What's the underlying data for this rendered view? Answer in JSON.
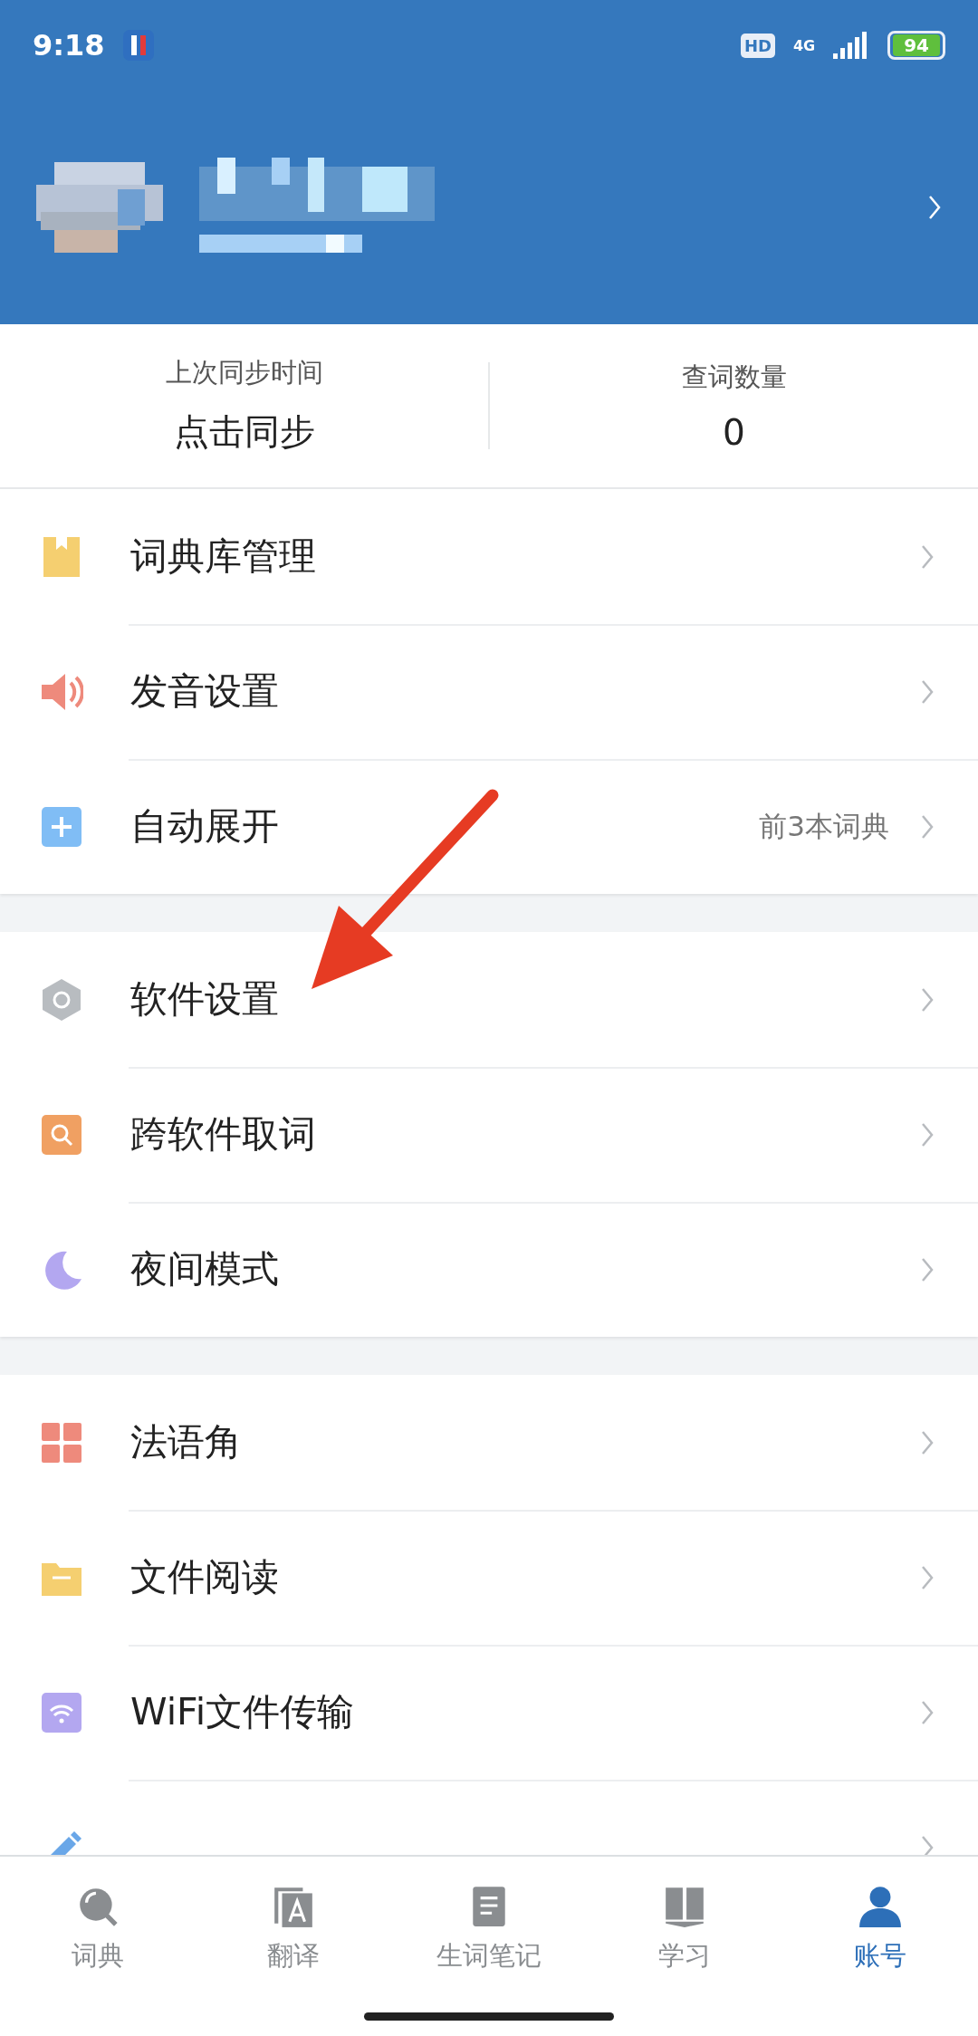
{
  "status_bar": {
    "time": "9:18",
    "hd": "HD",
    "network": "4G",
    "battery": "94"
  },
  "stats": [
    {
      "label": "上次同步时间",
      "value": "点击同步"
    },
    {
      "label": "查词数量",
      "value": "0"
    }
  ],
  "groups": [
    [
      {
        "kind": "bookmark",
        "label": "词典库管理"
      },
      {
        "kind": "speaker",
        "label": "发音设置"
      },
      {
        "kind": "plus",
        "label": "自动展开",
        "detail": "前3本词典"
      }
    ],
    [
      {
        "kind": "hexagon",
        "label": "软件设置"
      },
      {
        "kind": "search",
        "label": "跨软件取词"
      },
      {
        "kind": "moon",
        "label": "夜间模式"
      }
    ],
    [
      {
        "kind": "grid",
        "label": "法语角"
      },
      {
        "kind": "folder",
        "label": "文件阅读"
      },
      {
        "kind": "wifi",
        "label": "WiFi文件传输"
      },
      {
        "kind": "pencil"
      }
    ]
  ],
  "tabs": [
    {
      "kind": "search",
      "label": "词典",
      "selected": false
    },
    {
      "kind": "translate",
      "label": "翻译",
      "selected": false
    },
    {
      "kind": "note",
      "label": "生词笔记",
      "selected": false
    },
    {
      "kind": "book",
      "label": "学习",
      "selected": false
    },
    {
      "kind": "person",
      "label": "账号",
      "selected": true
    }
  ]
}
